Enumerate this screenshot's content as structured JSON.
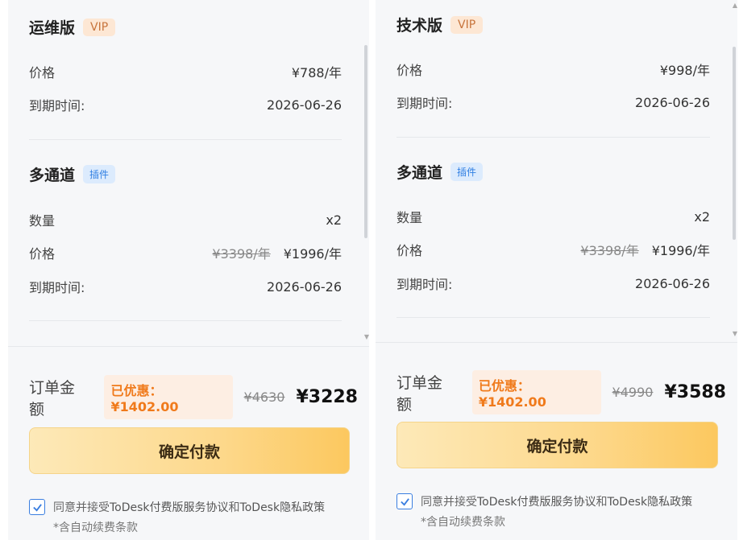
{
  "plans": [
    {
      "title": "运维版",
      "vip_badge": "VIP",
      "price_label": "价格",
      "price_value": "¥788/年",
      "expiry_label": "到期时间:",
      "expiry_value": "2026-06-26",
      "addon": {
        "title": "多通道",
        "badge": "插件",
        "qty_label": "数量",
        "qty_value": "x2",
        "price_label": "价格",
        "price_original": "¥3398/年",
        "price_value": "¥1996/年",
        "expiry_label": "到期时间:",
        "expiry_value": "2026-06-26"
      },
      "order": {
        "label": "订单金额",
        "discount": "已优惠：¥1402.00",
        "original_total": "¥4630",
        "total": "¥3228"
      },
      "pay_button": "确定付款",
      "agree_prefix": "同意并接受",
      "agree_link1": "ToDesk付费版服务协议",
      "agree_and": "和",
      "agree_link2": "ToDesk隐私政策",
      "note": "*含自动续费条款"
    },
    {
      "title": "技术版",
      "vip_badge": "VIP",
      "price_label": "价格",
      "price_value": "¥998/年",
      "expiry_label": "到期时间:",
      "expiry_value": "2026-06-26",
      "addon": {
        "title": "多通道",
        "badge": "插件",
        "qty_label": "数量",
        "qty_value": "x2",
        "price_label": "价格",
        "price_original": "¥3398/年",
        "price_value": "¥1996/年",
        "expiry_label": "到期时间:",
        "expiry_value": "2026-06-26"
      },
      "order": {
        "label": "订单金额",
        "discount": "已优惠：¥1402.00",
        "original_total": "¥4990",
        "total": "¥3588"
      },
      "pay_button": "确定付款",
      "agree_prefix": "同意并接受",
      "agree_link1": "ToDesk付费版服务协议",
      "agree_and": "和",
      "agree_link2": "ToDesk隐私政策",
      "note": "*含自动续费条款"
    }
  ],
  "icons": {
    "checkbox": "check-icon",
    "scroll_up": "chevron-up-icon",
    "scroll_down": "chevron-down-icon"
  },
  "colors": {
    "vip_badge_bg": "#fde7d4",
    "plugin_badge_bg": "#dcebfd",
    "discount_text": "#f07a1b",
    "checkbox_border": "#3a7ee0"
  }
}
